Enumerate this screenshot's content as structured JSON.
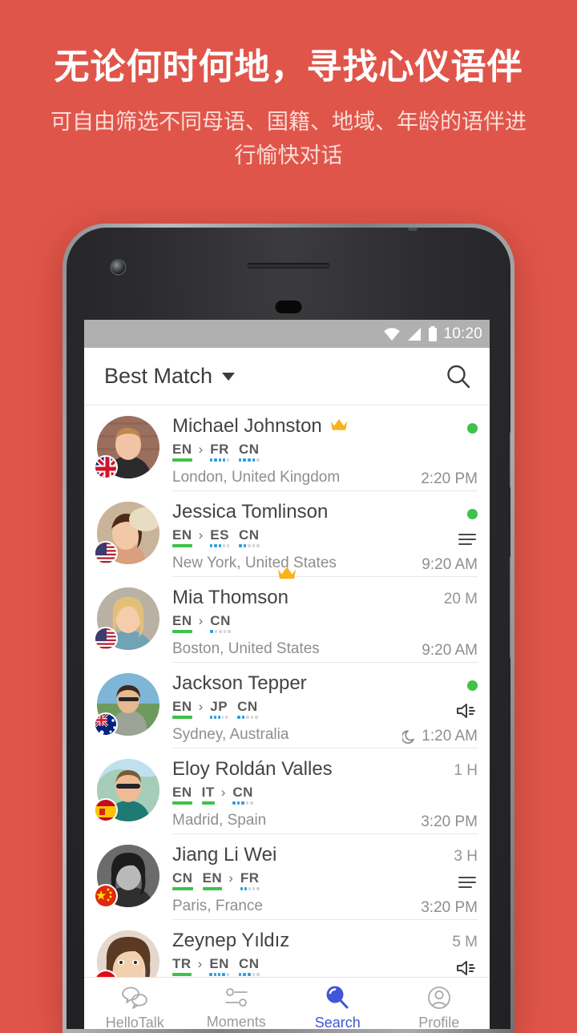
{
  "promo": {
    "title": "无论何时何地，寻找心仪语伴",
    "subtitle": "可自由筛选不同母语、国籍、地域、年龄的语伴进行愉快对话"
  },
  "colors": {
    "background": "#e0554a",
    "accent_blue": "#4055d8",
    "native_green": "#3ec24a",
    "learning_blue": "#2f9fe0",
    "crown_gold": "#f9b21c",
    "statusbar_gray": "#b0b0b0"
  },
  "statusbar": {
    "time": "10:20",
    "icons": [
      "wifi-icon",
      "signal-icon",
      "battery-icon"
    ]
  },
  "appbar": {
    "title": "Best Match",
    "caret": "chevron-down-icon",
    "search_icon": "search-icon"
  },
  "list": [
    {
      "name": "Michael Johnston",
      "vip": true,
      "languages": [
        {
          "code": "EN",
          "native": true,
          "level": 5
        },
        {
          "sep": true
        },
        {
          "code": "FR",
          "native": false,
          "level": 4
        },
        {
          "code": "CN",
          "native": false,
          "level": 4
        }
      ],
      "location": "London, United Kingdom",
      "flag": "uk-flag",
      "online": true,
      "status": "",
      "badge_icon": "",
      "time": "2:20 PM",
      "night": false,
      "crown_below": false
    },
    {
      "name": "Jessica Tomlinson",
      "vip": false,
      "languages": [
        {
          "code": "EN",
          "native": true,
          "level": 5
        },
        {
          "sep": true
        },
        {
          "code": "ES",
          "native": false,
          "level": 3
        },
        {
          "code": "CN",
          "native": false,
          "level": 2
        }
      ],
      "location": "New York, United States",
      "flag": "us-flag",
      "online": true,
      "status": "",
      "badge_icon": "text-lines-icon",
      "time": "9:20 AM",
      "night": false,
      "crown_below": true
    },
    {
      "name": "Mia Thomson",
      "vip": false,
      "languages": [
        {
          "code": "EN",
          "native": true,
          "level": 5
        },
        {
          "sep": true
        },
        {
          "code": "CN",
          "native": false,
          "level": 1
        }
      ],
      "location": "Boston, United States",
      "flag": "us-flag",
      "online": false,
      "status": "20 M",
      "badge_icon": "",
      "time": "9:20 AM",
      "night": false,
      "crown_below": false
    },
    {
      "name": "Jackson Tepper",
      "vip": false,
      "languages": [
        {
          "code": "EN",
          "native": true,
          "level": 5
        },
        {
          "sep": true
        },
        {
          "code": "JP",
          "native": false,
          "level": 3
        },
        {
          "code": "CN",
          "native": false,
          "level": 2
        }
      ],
      "location": "Sydney, Australia",
      "flag": "au-flag",
      "online": true,
      "status": "",
      "badge_icon": "speaker-icon",
      "time": "1:20 AM",
      "night": true,
      "crown_below": false
    },
    {
      "name": "Eloy Roldán Valles",
      "vip": false,
      "languages": [
        {
          "code": "EN",
          "native": true,
          "level": 5
        },
        {
          "code": "IT",
          "native": true,
          "level": 5
        },
        {
          "sep": true
        },
        {
          "code": "CN",
          "native": false,
          "level": 3
        }
      ],
      "location": "Madrid, Spain",
      "flag": "es-flag",
      "online": false,
      "status": "1 H",
      "badge_icon": "",
      "time": "3:20 PM",
      "night": false,
      "crown_below": false
    },
    {
      "name": "Jiang Li Wei",
      "vip": false,
      "languages": [
        {
          "code": "CN",
          "native": true,
          "level": 5
        },
        {
          "code": "EN",
          "native": true,
          "level": 5
        },
        {
          "sep": true
        },
        {
          "code": "FR",
          "native": false,
          "level": 2
        }
      ],
      "location": "Paris, France",
      "flag": "cn-flag",
      "online": false,
      "status": "3 H",
      "badge_icon": "text-lines-icon",
      "time": "3:20 PM",
      "night": false,
      "crown_below": false
    },
    {
      "name": "Zeynep Yıldız",
      "vip": false,
      "languages": [
        {
          "code": "TR",
          "native": true,
          "level": 5
        },
        {
          "sep": true
        },
        {
          "code": "EN",
          "native": false,
          "level": 4
        },
        {
          "code": "CN",
          "native": false,
          "level": 3
        }
      ],
      "location": "",
      "flag": "tr-flag",
      "online": false,
      "status": "5 M",
      "badge_icon": "speaker-icon",
      "time": "",
      "night": false,
      "crown_below": false
    }
  ],
  "bottomnav": {
    "items": [
      {
        "label": "HelloTalk",
        "icon": "chat-bubbles-icon",
        "active": false
      },
      {
        "label": "Moments",
        "icon": "sliders-icon",
        "active": false
      },
      {
        "label": "Search",
        "icon": "search-filled-icon",
        "active": true
      },
      {
        "label": "Profile",
        "icon": "person-icon",
        "active": false
      }
    ]
  }
}
